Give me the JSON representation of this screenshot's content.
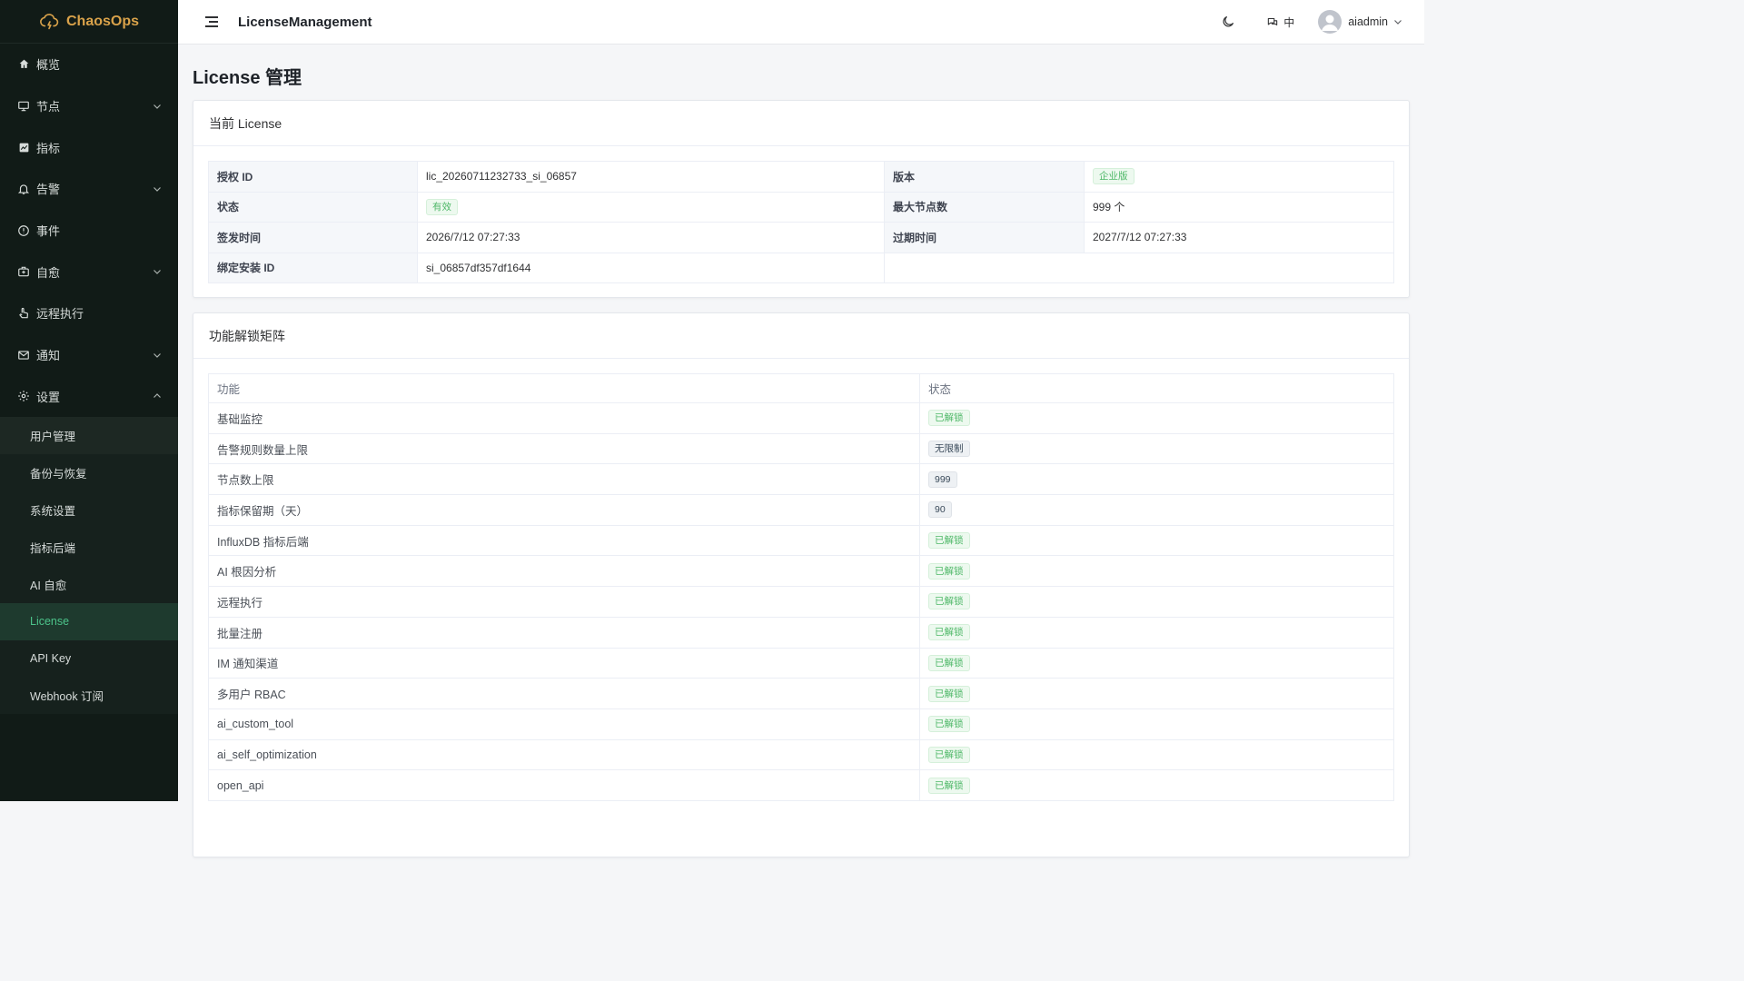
{
  "app": {
    "name": "ChaosOps"
  },
  "sidebar": {
    "items": [
      {
        "label": "概览",
        "icon": "home-icon",
        "chevron": ""
      },
      {
        "label": "节点",
        "icon": "monitor-icon",
        "chevron": "down"
      },
      {
        "label": "指标",
        "icon": "chart-icon",
        "chevron": ""
      },
      {
        "label": "告警",
        "icon": "bell-icon",
        "chevron": "down"
      },
      {
        "label": "事件",
        "icon": "alert-circle-icon",
        "chevron": ""
      },
      {
        "label": "自愈",
        "icon": "medkit-icon",
        "chevron": "down"
      },
      {
        "label": "远程执行",
        "icon": "hand-icon",
        "chevron": ""
      },
      {
        "label": "通知",
        "icon": "mail-icon",
        "chevron": "down"
      },
      {
        "label": "设置",
        "icon": "gear-icon",
        "chevron": "up"
      }
    ],
    "settings_children": [
      {
        "label": "用户管理"
      },
      {
        "label": "备份与恢复"
      },
      {
        "label": "系统设置"
      },
      {
        "label": "指标后端"
      },
      {
        "label": "AI 自愈"
      },
      {
        "label": "License",
        "active": true
      },
      {
        "label": "API Key"
      },
      {
        "label": "Webhook 订阅"
      }
    ]
  },
  "header": {
    "title": "LicenseManagement",
    "lang": "中",
    "user": "aiadmin"
  },
  "page": {
    "title": "License 管理"
  },
  "current_license": {
    "card_title": "当前 License",
    "rows": [
      {
        "l1": "授权 ID",
        "v1": "lic_20260711232733_si_06857",
        "l2": "版本",
        "v2": "企业版"
      },
      {
        "l1": "状态",
        "v1": "有效",
        "l2": "最大节点数",
        "v2": "999 个"
      },
      {
        "l1": "签发时间",
        "v1": "2026/7/12 07:27:33",
        "l2": "过期时间",
        "v2": "2027/7/12 07:27:33"
      },
      {
        "l1": "绑定安装 ID",
        "v1": "si_06857df357df1644"
      }
    ]
  },
  "feature_matrix": {
    "card_title": "功能解锁矩阵",
    "columns": [
      "功能",
      "状态"
    ],
    "rows": [
      {
        "feature": "基础监控",
        "status": "已解锁",
        "style": "green"
      },
      {
        "feature": "告警规则数量上限",
        "status": "无限制",
        "style": "gray"
      },
      {
        "feature": "节点数上限",
        "status": "999",
        "style": "gray"
      },
      {
        "feature": "指标保留期（天）",
        "status": "90",
        "style": "gray"
      },
      {
        "feature": "InfluxDB 指标后端",
        "status": "已解锁",
        "style": "green"
      },
      {
        "feature": "AI 根因分析",
        "status": "已解锁",
        "style": "green"
      },
      {
        "feature": "远程执行",
        "status": "已解锁",
        "style": "green"
      },
      {
        "feature": "批量注册",
        "status": "已解锁",
        "style": "green"
      },
      {
        "feature": "IM 通知渠道",
        "status": "已解锁",
        "style": "green"
      },
      {
        "feature": "多用户 RBAC",
        "status": "已解锁",
        "style": "green"
      },
      {
        "feature": "ai_custom_tool",
        "status": "已解锁",
        "style": "green"
      },
      {
        "feature": "ai_self_optimization",
        "status": "已解锁",
        "style": "green"
      },
      {
        "feature": "open_api",
        "status": "已解锁",
        "style": "green"
      }
    ]
  },
  "colors": {
    "sidebar_bg": "#111b17",
    "brand": "#d9a24a",
    "active_text": "#4cc38a",
    "tag_green": "#4fb868"
  }
}
